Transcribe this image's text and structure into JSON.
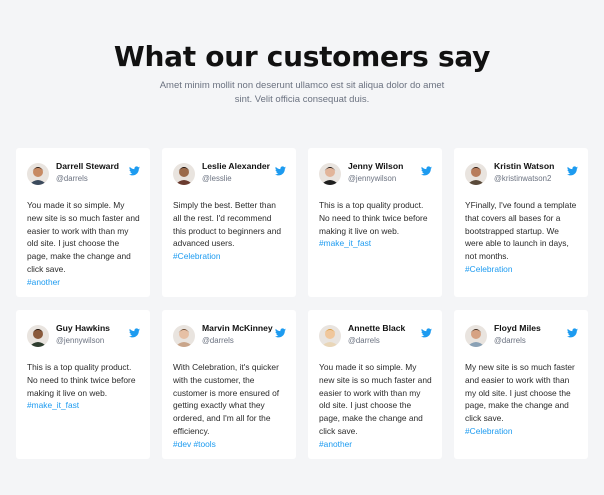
{
  "section": {
    "title": "What our customers say",
    "subtitle": "Amet minim mollit non deserunt ullamco est sit aliqua dolor do amet sint. Velit officia consequat duis."
  },
  "testimonials": [
    {
      "name": "Darrell Steward",
      "handle": "@darrels",
      "text": "You made it so simple. My new site is so much faster and easier to work with than my old site. I just choose the page, make the change and click save.",
      "tags": "#another",
      "avatar": "avatar-1"
    },
    {
      "name": "Leslie Alexander",
      "handle": "@lesslie",
      "text": "Simply the best. Better than all the rest. I'd recommend this product to beginners and advanced users.",
      "tags": "#Celebration",
      "avatar": "avatar-2"
    },
    {
      "name": "Jenny Wilson",
      "handle": "@jennywilson",
      "text": "This is a top quality product. No need to think twice before making it live on web.",
      "tags": "#make_it_fast",
      "avatar": "avatar-3"
    },
    {
      "name": "Kristin Watson",
      "handle": "@kristinwatson2",
      "text": "YFinally, I've found a template that covers all bases for a bootstrapped startup. We were able to launch in days, not months.",
      "tags": "#Celebration",
      "avatar": "avatar-4"
    },
    {
      "name": "Guy Hawkins",
      "handle": "@jennywilson",
      "text": "This is a top quality product. No need to think twice before making it live on web.",
      "tags": "#make_it_fast",
      "avatar": "avatar-5"
    },
    {
      "name": "Marvin McKinney",
      "handle": "@darrels",
      "text": "With Celebration, it's quicker with the customer, the customer is more ensured of getting exactly what they ordered, and I'm all for the efficiency.",
      "tags": "#dev #tools",
      "avatar": "avatar-6"
    },
    {
      "name": "Annette Black",
      "handle": "@darrels",
      "text": "You made it so simple. My new site is so much faster and easier to work with than my old site. I just choose the page, make the change and click save.",
      "tags": "#another",
      "avatar": "avatar-7"
    },
    {
      "name": "Floyd Miles",
      "handle": "@darrels",
      "text": "My new site is so much faster and easier to work with than my old site. I just choose the page, make the change and click save.",
      "tags": "#Celebration",
      "avatar": "avatar-8"
    }
  ],
  "icons": {
    "social": "twitter-icon"
  },
  "colors": {
    "tag": "#1d9bf0",
    "twitter": "#1d9bf0",
    "background": "#f4f5f7",
    "card": "#ffffff"
  }
}
